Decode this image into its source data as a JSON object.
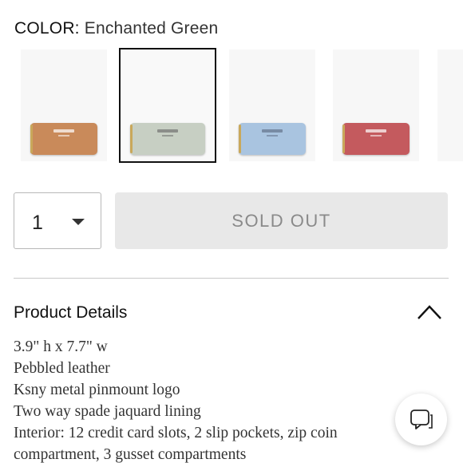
{
  "color_selector": {
    "label": "COLOR:",
    "value": "Enchanted Green",
    "swatches": [
      {
        "name": "tan",
        "color": "#c98a5a",
        "selected": false
      },
      {
        "name": "Enchanted Green",
        "color": "#c7cfc3",
        "selected": true
      },
      {
        "name": "light blue",
        "color": "#a9c4e0",
        "selected": false
      },
      {
        "name": "rose",
        "color": "#c45a5e",
        "selected": false
      }
    ]
  },
  "quantity": {
    "value": "1"
  },
  "buy_button": {
    "label": "SOLD OUT"
  },
  "product_details": {
    "title": "Product Details",
    "items": [
      "3.9\" h x 7.7\" w",
      "Pebbled leather",
      "Ksny metal pinmount logo",
      "Two way spade jaquard lining",
      "Interior: 12 credit card slots, 2 slip pockets, zip coin",
      "compartment, 3 gusset compartments"
    ]
  },
  "icons": {
    "collapse": "chevron-up-icon",
    "chat": "chat-bubble-icon",
    "quantity_dropdown": "caret-down-icon"
  }
}
